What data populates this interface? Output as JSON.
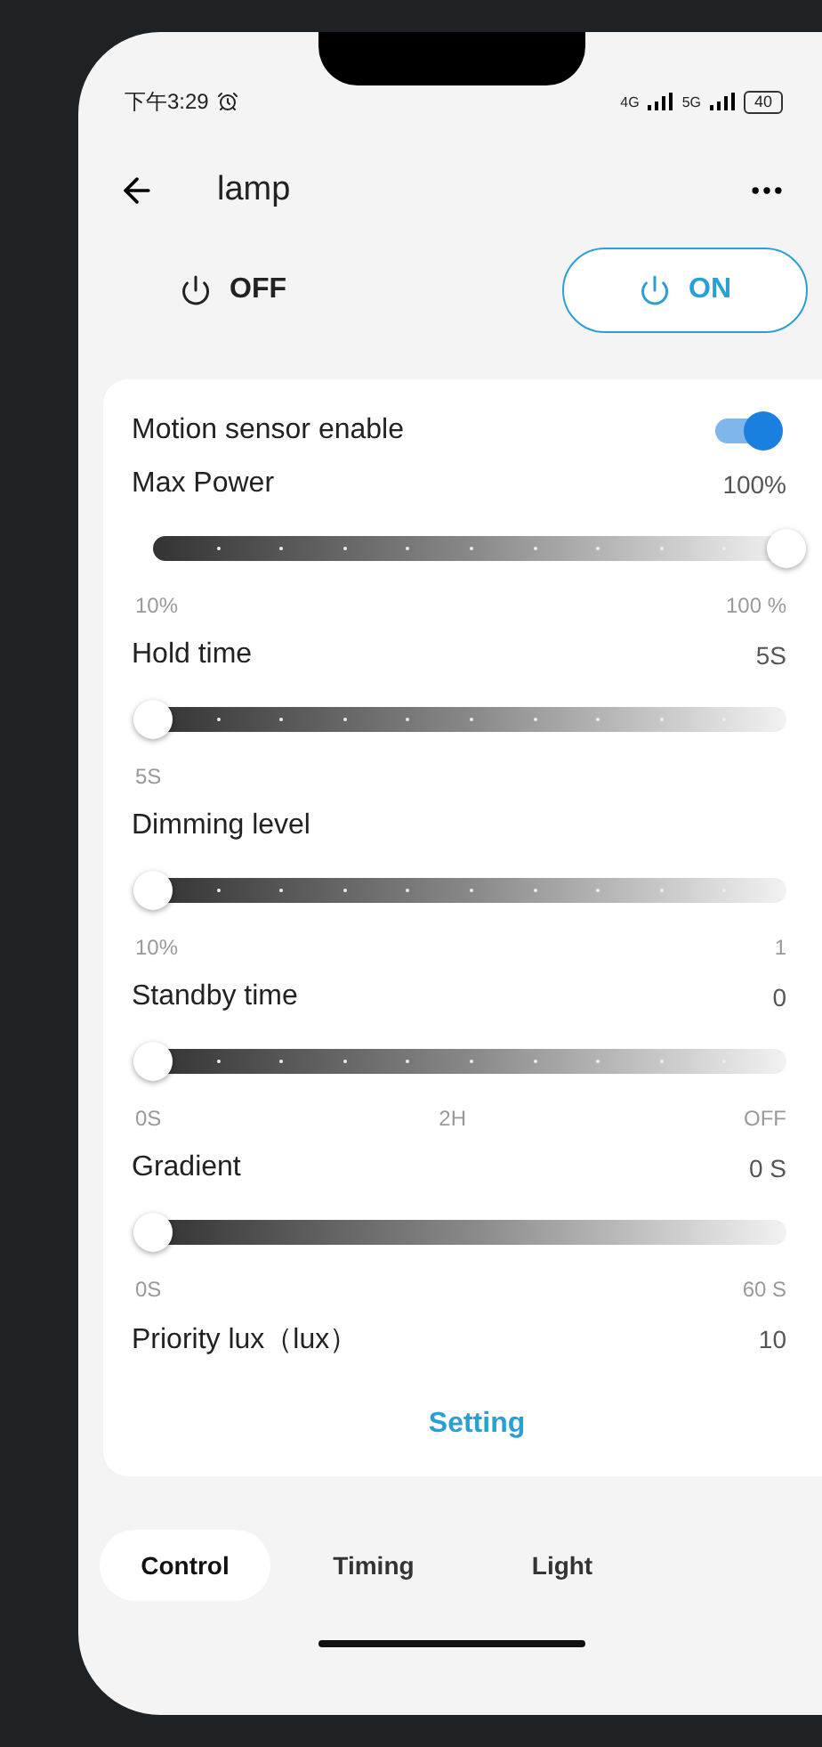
{
  "status_bar": {
    "time": "下午3:29",
    "network_1": "4G",
    "network_2": "5G",
    "battery": "40"
  },
  "header": {
    "title": "lamp"
  },
  "power_buttons": [
    {
      "label": "OFF",
      "selected": false
    },
    {
      "label": "ON",
      "selected": true
    }
  ],
  "motion_sensor": {
    "label": "Motion sensor enable",
    "on": true
  },
  "sliders": [
    {
      "label": "Max Power",
      "value": "100%",
      "kind": "stepped",
      "level": 1,
      "scale": [
        "10%",
        "100 %"
      ]
    },
    {
      "label": "Hold time",
      "value": "5S",
      "kind": "stepped",
      "level": 0,
      "scale": [
        "5S"
      ]
    },
    {
      "label": "Dimming level",
      "kind": "stepped",
      "level": 0,
      "scale": [
        "10%",
        "1"
      ]
    },
    {
      "label": "Standby time",
      "value": "0",
      "kind": "stepped",
      "level": 0,
      "scale": [
        "0S",
        "2H",
        "OFF"
      ]
    },
    {
      "label": "Gradient",
      "value": "0 S",
      "kind": "continuous",
      "level": 0,
      "scale": [
        "0S",
        "60 S"
      ]
    }
  ],
  "priority_lux": {
    "label": "Priority lux（lux）",
    "value": "10"
  },
  "setting_button": "Setting",
  "bottom_tabs": [
    {
      "label": "Control",
      "selected": true
    },
    {
      "label": "Timing",
      "selected": false
    },
    {
      "label": "Light",
      "selected": false
    }
  ]
}
